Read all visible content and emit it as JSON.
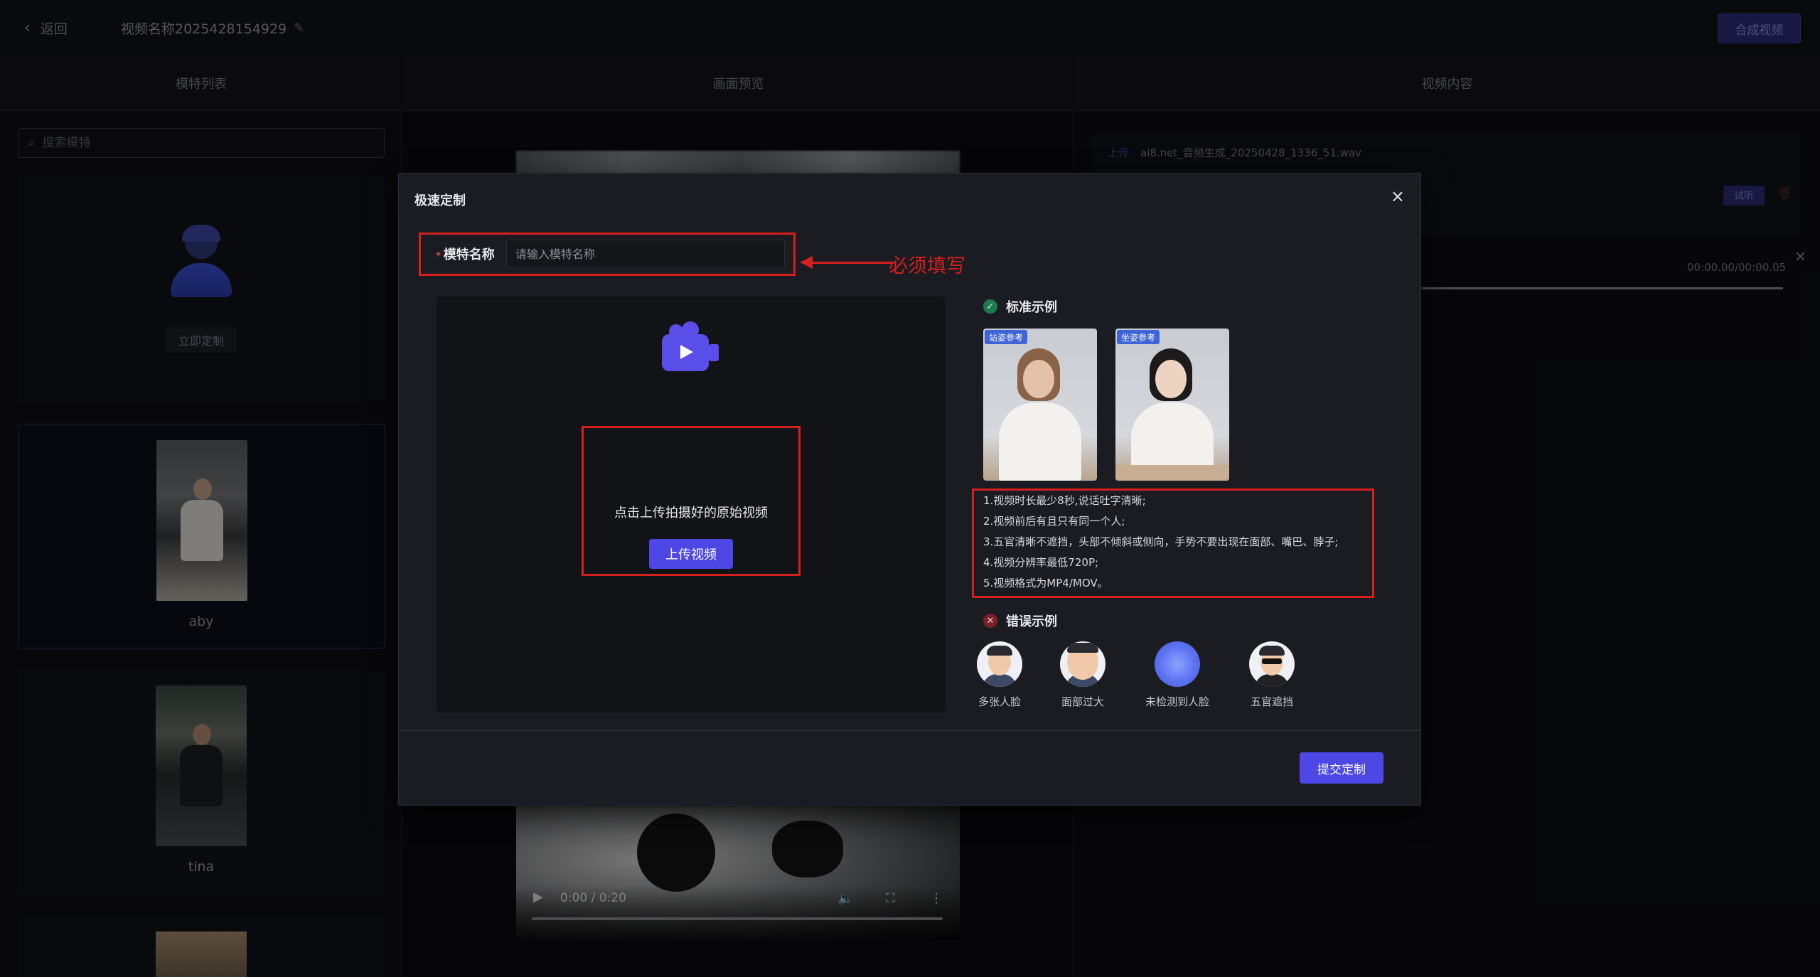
{
  "topbar": {
    "back_label": "返回",
    "video_name": "视频名称2025428154929",
    "compose_button": "合成视频"
  },
  "columns": {
    "models": "模特列表",
    "preview": "画面预览",
    "content": "视频内容"
  },
  "model_list": {
    "search_placeholder": "搜索模特",
    "custom_button": "立即定制",
    "models": [
      {
        "name": "aby"
      },
      {
        "name": "tina"
      }
    ]
  },
  "preview": {
    "time": "0:00 / 0:20"
  },
  "content": {
    "upload_link": "上传",
    "file_name": "ai8.net_音频生成_20250428_1336_51.wav",
    "try_button": "试听",
    "time": "00:00.00/00:00.05"
  },
  "modal": {
    "title": "极速定制",
    "name_label": "模特名称",
    "name_placeholder": "请输入模特名称",
    "annotation": "必须填写",
    "upload_hint": "点击上传拍摄好的原始视频",
    "upload_button": "上传视频",
    "good_title": "标准示例",
    "good_examples": [
      {
        "tag": "站姿参考"
      },
      {
        "tag": "坐姿参考"
      }
    ],
    "rules": [
      "1.视频时长最少8秒,说话吐字清晰;",
      "2.视频前后有且只有同一个人;",
      "3.五官清晰不遮挡，头部不倾斜或侧向，手势不要出现在面部、嘴巴、脖子;",
      "4.视频分辨率最低720P;",
      "5.视频格式为MP4/MOV。"
    ],
    "bad_title": "错误示例",
    "bad_examples": [
      {
        "label": "多张人脸"
      },
      {
        "label": "面部过大"
      },
      {
        "label": "未检测到人脸"
      },
      {
        "label": "五官遮挡"
      }
    ],
    "submit_button": "提交定制"
  },
  "colors": {
    "accent": "#4d47e6",
    "annotation_red": "#d71f1f",
    "modal_bg": "#1b1c21",
    "page_bg": "#0c0d10"
  }
}
